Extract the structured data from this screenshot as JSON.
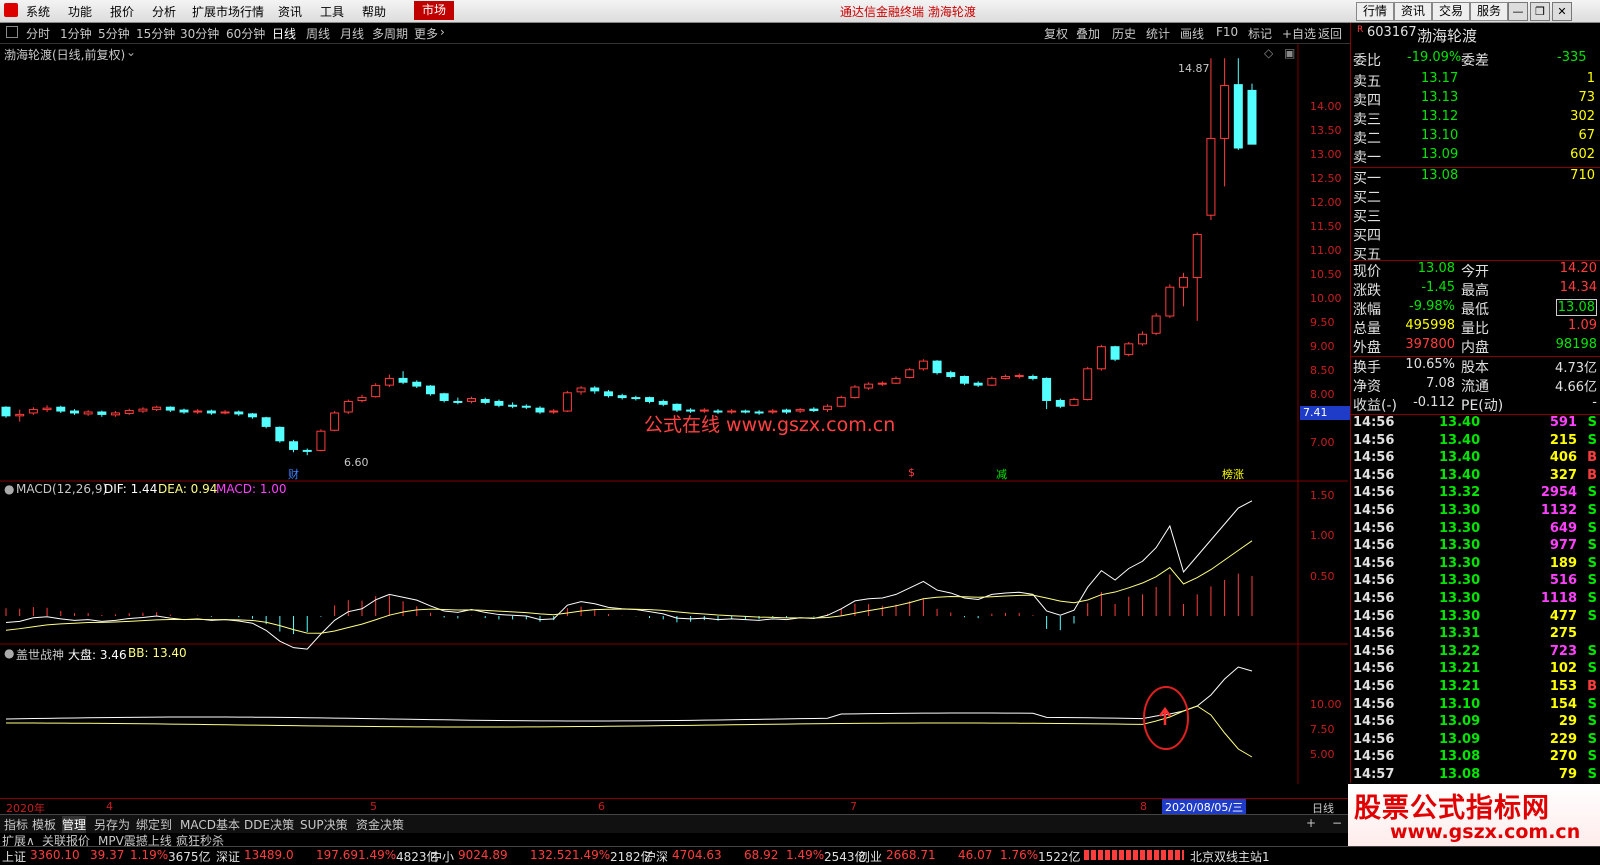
{
  "menubar": {
    "items": [
      "系统",
      "功能",
      "报价",
      "分析",
      "扩展市场行情",
      "资讯",
      "工具",
      "帮助"
    ],
    "market_tab": "市场",
    "title": "通达信金融终端  渤海轮渡",
    "right_buttons": [
      "行情",
      "资讯",
      "交易",
      "服务"
    ]
  },
  "periodbar": {
    "periods": [
      "分时",
      "1分钟",
      "5分钟",
      "15分钟",
      "30分钟",
      "60分钟",
      "日线",
      "周线",
      "月线",
      "多周期",
      "更多"
    ],
    "active": "日线",
    "tools": [
      "复权",
      "叠加",
      "历史",
      "统计",
      "画线",
      "F10",
      "标记",
      "+自选",
      "返回"
    ]
  },
  "chart": {
    "title": "渤海轮渡(日线,前复权)",
    "high_label": "14.87",
    "low_label": "6.60",
    "price_tag": "7.41",
    "y_labels": [
      "14.00",
      "13.50",
      "13.00",
      "12.50",
      "12.00",
      "11.50",
      "11.00",
      "10.50",
      "10.00",
      "9.50",
      "9.00",
      "8.50",
      "8.00",
      "7.00"
    ],
    "markers": [
      "财",
      "$",
      "减",
      "榜涨"
    ],
    "watermark": "公式在线 www.gszx.com.cn",
    "macd_label": "MACD(12,26,9)",
    "macd_dif": "DIF: 1.44",
    "macd_dea": "DEA: 0.94",
    "macd_val": "MACD: 1.00",
    "macd_y": [
      "1.50",
      "1.00",
      "0.50"
    ],
    "ind_label": "盖世战神",
    "ind_dapan": "大盘: 3.46",
    "ind_bb": "BB: 13.40",
    "ind_y": [
      "10.00",
      "7.50",
      "5.00"
    ],
    "time_labels": [
      "2020年",
      "4",
      "5",
      "6",
      "7",
      "8"
    ],
    "date_cursor": "2020/08/05/三",
    "period_tag": "日线"
  },
  "bottom_tabs": [
    "指标",
    "模板",
    "管理",
    "另存为",
    "绑定到",
    "MACD基本",
    "DDE决策",
    "SUP决策",
    "资金决策"
  ],
  "ext_tabs": [
    "扩展∧",
    "关联报价",
    "MPV震撼上线",
    "疯狂秒杀"
  ],
  "quote": {
    "code": "603167",
    "name": "渤海轮渡",
    "weibi_label": "委比",
    "weibi": "-19.09%",
    "weicha_label": "委差",
    "weicha": "-335",
    "sells": [
      [
        "卖五",
        "13.17",
        "1"
      ],
      [
        "卖四",
        "13.13",
        "73"
      ],
      [
        "卖三",
        "13.12",
        "302"
      ],
      [
        "卖二",
        "13.10",
        "67"
      ],
      [
        "卖一",
        "13.09",
        "602"
      ]
    ],
    "buys": [
      [
        "买一",
        "13.08",
        "710"
      ],
      [
        "买二",
        "",
        ""
      ],
      [
        "买三",
        "",
        ""
      ],
      [
        "买四",
        "",
        ""
      ],
      [
        "买五",
        "",
        ""
      ]
    ],
    "stats": [
      [
        "现价",
        "13.08",
        "今开",
        "14.20"
      ],
      [
        "涨跌",
        "-1.45",
        "最高",
        "14.34"
      ],
      [
        "涨幅",
        "-9.98%",
        "最低",
        "13.08"
      ],
      [
        "总量",
        "495998",
        "量比",
        "1.09"
      ],
      [
        "外盘",
        "397800",
        "内盘",
        "98198"
      ]
    ],
    "stats2": [
      [
        "换手",
        "10.65%",
        "股本",
        "4.73亿"
      ],
      [
        "净资",
        "7.08",
        "流通",
        "4.66亿"
      ],
      [
        "收益(-)",
        "-0.112",
        "PE(动)",
        "-"
      ]
    ],
    "ticks": [
      [
        "14:56",
        "13.40",
        "591",
        "S"
      ],
      [
        "14:56",
        "13.40",
        "215",
        "S"
      ],
      [
        "14:56",
        "13.40",
        "406",
        "B"
      ],
      [
        "14:56",
        "13.40",
        "327",
        "B"
      ],
      [
        "14:56",
        "13.32",
        "2954",
        "S"
      ],
      [
        "14:56",
        "13.30",
        "1132",
        "S"
      ],
      [
        "14:56",
        "13.30",
        "649",
        "S"
      ],
      [
        "14:56",
        "13.30",
        "977",
        "S"
      ],
      [
        "14:56",
        "13.30",
        "189",
        "S"
      ],
      [
        "14:56",
        "13.30",
        "516",
        "S"
      ],
      [
        "14:56",
        "13.30",
        "1118",
        "S"
      ],
      [
        "14:56",
        "13.30",
        "477",
        "S"
      ],
      [
        "14:56",
        "13.31",
        "275",
        ""
      ],
      [
        "14:56",
        "13.22",
        "723",
        "S"
      ],
      [
        "14:56",
        "13.21",
        "102",
        "S"
      ],
      [
        "14:56",
        "13.21",
        "153",
        "B"
      ],
      [
        "14:56",
        "13.10",
        "154",
        "S"
      ],
      [
        "14:56",
        "13.09",
        "29",
        "S"
      ],
      [
        "14:56",
        "13.09",
        "229",
        "S"
      ],
      [
        "14:56",
        "13.08",
        "270",
        "S"
      ],
      [
        "14:57",
        "13.08",
        "79",
        "S"
      ]
    ]
  },
  "ad": {
    "line1": "股票公式指标网",
    "line2": "www.gszx.com.cn"
  },
  "ticker": [
    [
      "上证",
      "3360.10",
      "39.37",
      "1.19%",
      "3675亿"
    ],
    [
      "深证",
      "13489.0",
      "197.69",
      "1.49%",
      "4823亿"
    ],
    [
      "中小",
      "9024.89",
      "132.52",
      "1.49%",
      "2182亿"
    ],
    [
      "沪深",
      "4704.63",
      "68.92",
      "1.49%",
      "2543亿"
    ],
    [
      "创业",
      "2668.71",
      "46.07",
      "1.76%",
      "1522亿"
    ]
  ],
  "status": "北京双线主站1",
  "colors": {
    "up": "#ff3c3c",
    "down": "#54ffff",
    "bg": "#000000",
    "grid": "#800000"
  }
}
